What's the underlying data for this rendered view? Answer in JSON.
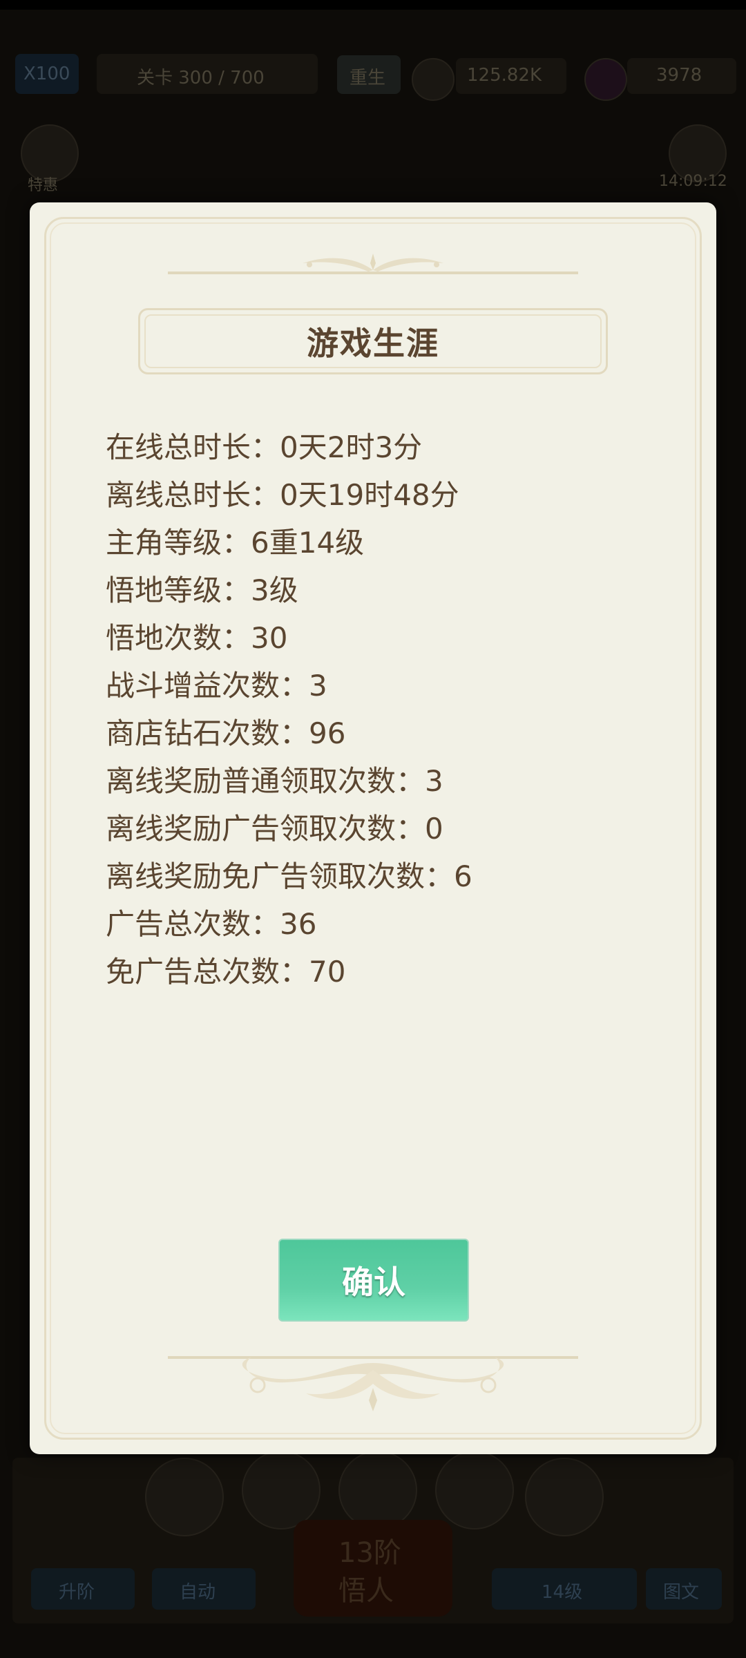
{
  "background_hud": {
    "speed_label": "X100",
    "stage_label": "关卡 300 / 700",
    "rebirth_label": "重生",
    "coins": "125.82K",
    "gems": "3978",
    "left_top_label": "特惠",
    "right_top_label": "14:09:12",
    "bottom_left_button": "升阶",
    "bottom_auto_button": "自动",
    "center_big_button_line1": "13阶",
    "center_big_button_line2": "悟人",
    "level_selector": "14级",
    "bottom_right_button": "图文"
  },
  "dialog": {
    "title": "游戏生涯",
    "stats": [
      "在线总时长：0天2时3分",
      "离线总时长：0天19时48分",
      "主角等级：6重14级",
      "悟地等级：3级",
      "悟地次数：30",
      "战斗增益次数：3",
      "商店钻石次数：96",
      "离线奖励普通领取次数：3",
      "离线奖励广告领取次数：0",
      "离线奖励免广告领取次数：6",
      "广告总次数：36",
      "免广告总次数：70"
    ],
    "confirm_label": "确认"
  },
  "colors": {
    "dialog_bg": "#f2f1e6",
    "text": "#5a4530",
    "button_green": "#52c89c",
    "frame": "#e4dcc3"
  }
}
